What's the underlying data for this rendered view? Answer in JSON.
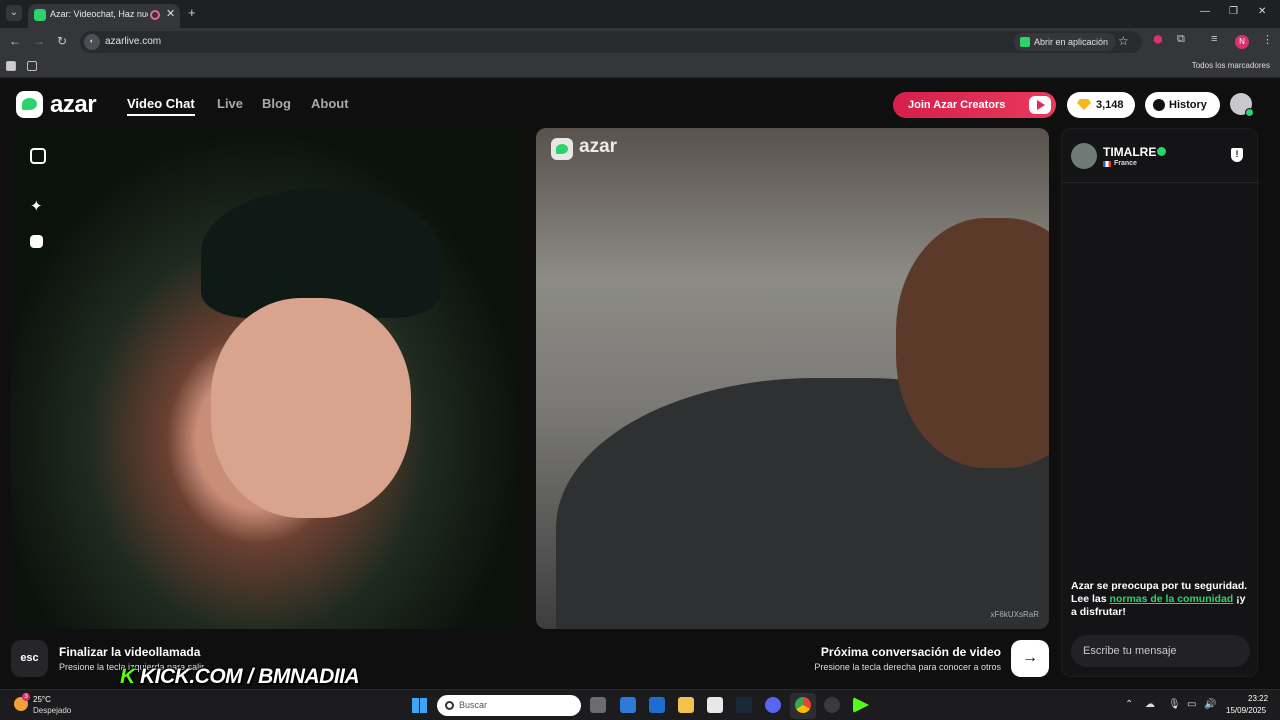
{
  "browser": {
    "tab_title": "Azar: Videochat, Haz nuevo",
    "url": "azarlive.com",
    "open_in_app": "Abrir en aplicación",
    "bookmarks_all": "Todos los marcadores",
    "profile_initial": "N"
  },
  "header": {
    "logo_text": "azar",
    "nav": [
      {
        "label": "Video Chat",
        "active": true
      },
      {
        "label": "Live",
        "active": false
      },
      {
        "label": "Blog",
        "active": false
      },
      {
        "label": "About",
        "active": false
      }
    ],
    "creators_button": "Join Azar Creators",
    "gems_count": "3,148",
    "history_button": "History"
  },
  "video_right": {
    "watermark": "azar",
    "id_text": "xF6kUXsRaR"
  },
  "chat": {
    "partner_name": "TIMALRE",
    "partner_country": "France",
    "safety_text_1": "Azar se preocupa por tu seguridad. Lee las ",
    "safety_link": "normas de la comunidad",
    "safety_text_2": " ¡y a disfrutar!",
    "message_placeholder": "Escribe tu mensaje"
  },
  "controls": {
    "esc_label": "esc",
    "end_title": "Finalizar la videollamada",
    "end_sub": "Presione la tecla izquierda para salir",
    "next_title": "Próxima conversación de video",
    "next_sub": "Presione la tecla derecha para conocer a otros",
    "next_arrow": "→"
  },
  "overlay": {
    "kick_k": "K",
    "kick_text": "KICK.COM / BMNADIIA"
  },
  "taskbar": {
    "temperature": "25°C",
    "weather": "Despejado",
    "weather_badge": "3",
    "search_placeholder": "Buscar",
    "time": "23:22",
    "date": "15/09/2025"
  },
  "colors": {
    "accent_green": "#2bd46a",
    "creators_red": "#e22a52",
    "gem_gold": "#f6b91b"
  }
}
